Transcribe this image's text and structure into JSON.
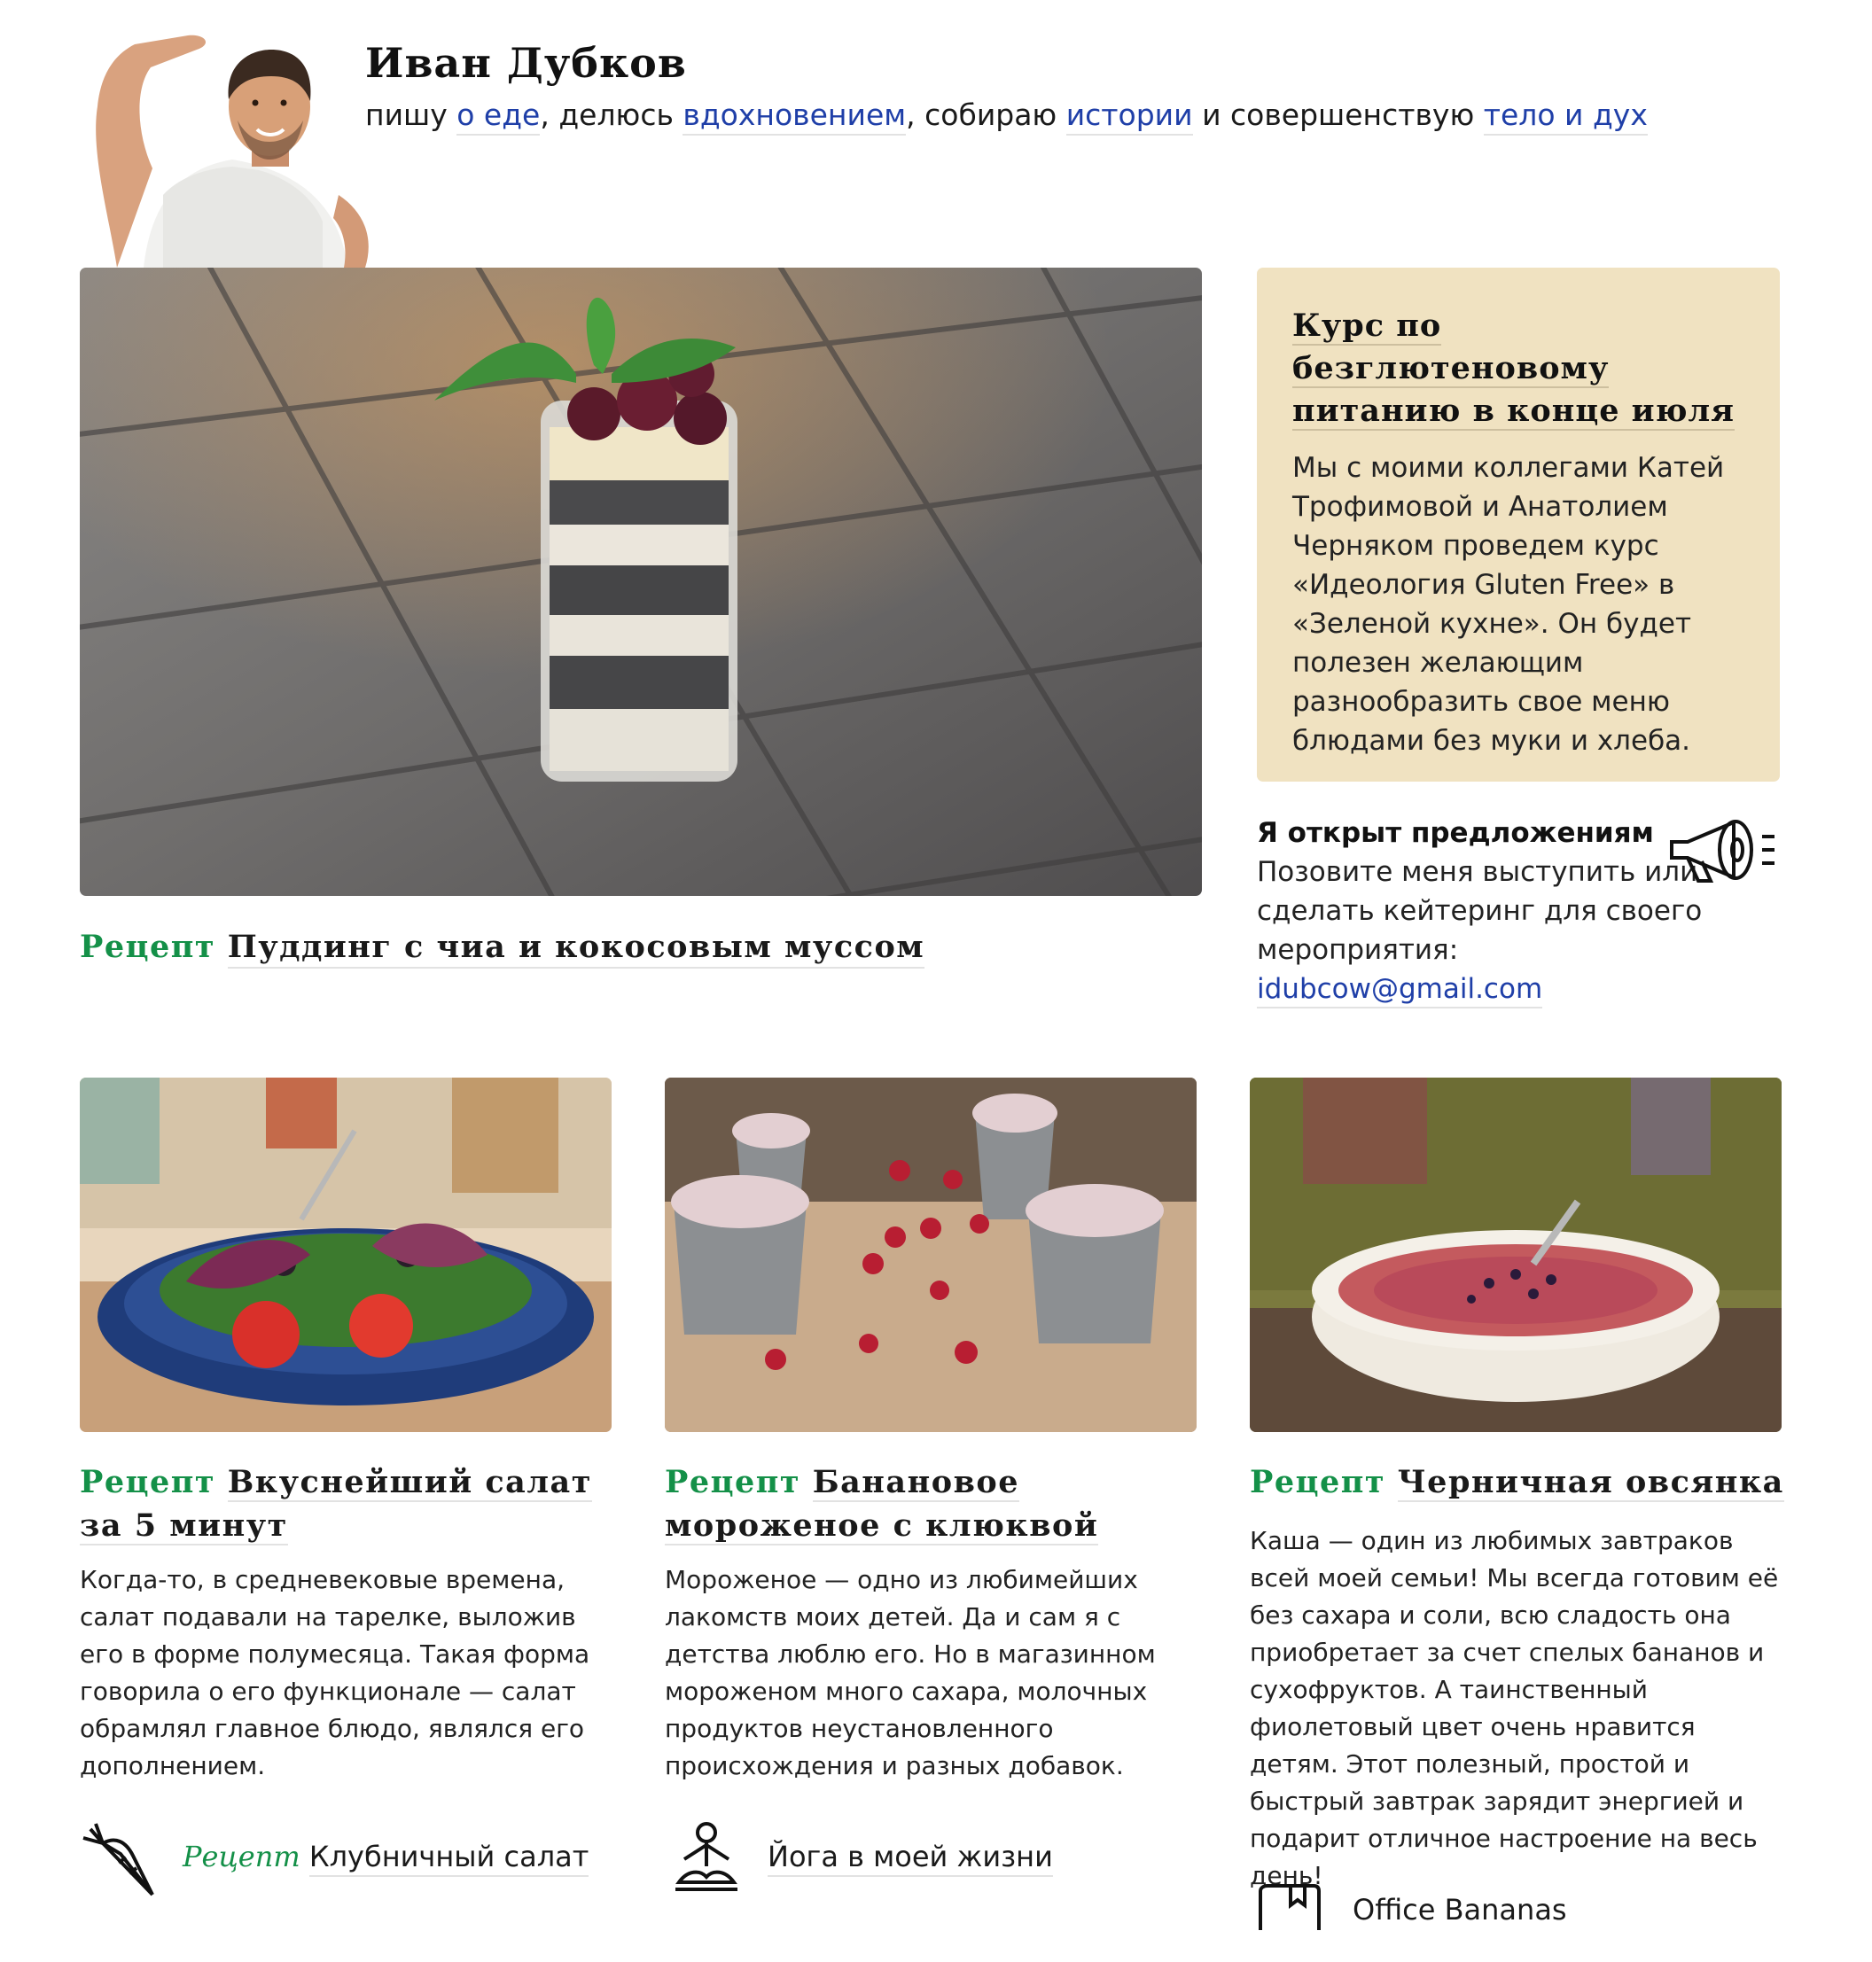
{
  "header": {
    "name": "Иван Дубков",
    "tagline": {
      "w1": "пишу ",
      "l1": "о еде",
      "w2": ", делюсь ",
      "l2": "вдохновением",
      "w3": ", собираю ",
      "l3": "истории",
      "w4": " и совершенствую ",
      "l4": "тело и дух"
    }
  },
  "hero": {
    "tag": "Рецепт",
    "title": "Пуддинг с чиа и кокосовым муссом"
  },
  "announcement": {
    "title": "Курс по безглютеновому питанию в конце июля",
    "text": "Мы с моими коллегами Катей Трофимовой и Анатолием Черняком проведем курс «Идеология Gluten Free» в «Зеленой кухне». Он будет полезен желающим разнообразить свое меню блюдами без муки и хлеба."
  },
  "offer": {
    "title": "Я открыт предложениям",
    "text": "Позовите меня выступить или сделать кейтеринг для своего мероприятия: ",
    "email": "idubcow@gmail.com",
    "icon": "megaphone-icon"
  },
  "cards": [
    {
      "tag": "Рецепт",
      "title": "Вкуснейший салат за 5 минут",
      "text": "Когда-то, в средневековые времена, салат подавали на тарелке, выложив его в форме полумесяца. Такая форма говорила о его функционале — салат обрамлял главное блюдо, являлся его дополнением."
    },
    {
      "tag": "Рецепт",
      "title": "Банановое мороженое с клюквой",
      "text": "Мороженое — одно из любимейших лакомств моих детей. Да и сам я с детства люблю его. Но в магазинном мороженом много сахара, молочных продуктов неустановленного происхождения и разных добавок."
    },
    {
      "tag": "Рецепт",
      "title": "Черничная овсянка",
      "text": "Каша — один из любимых завтраков всей моей семьи! Мы всегда готовим её без сахара и соли, всю сладость она приобретает за счет спелых бананов и сухофруктов. А таинственный фиолетовый цвет очень нравится детям. Этот полезный, простой и быстрый завтрак зарядит энергией и подарит отличное настроение на весь день!"
    }
  ],
  "bottom_links": [
    {
      "tag": "Рецепт",
      "label": "Клубничный салат",
      "icon": "carrot-icon"
    },
    {
      "label": "Йога в моей жизни",
      "icon": "yoga-icon"
    },
    {
      "label": "Office Bananas",
      "icon": "bookmark-icon"
    }
  ],
  "colors": {
    "accent_green": "#149048",
    "link_blue": "#1f3fa8",
    "announcement_bg": "#f0e2c1"
  }
}
